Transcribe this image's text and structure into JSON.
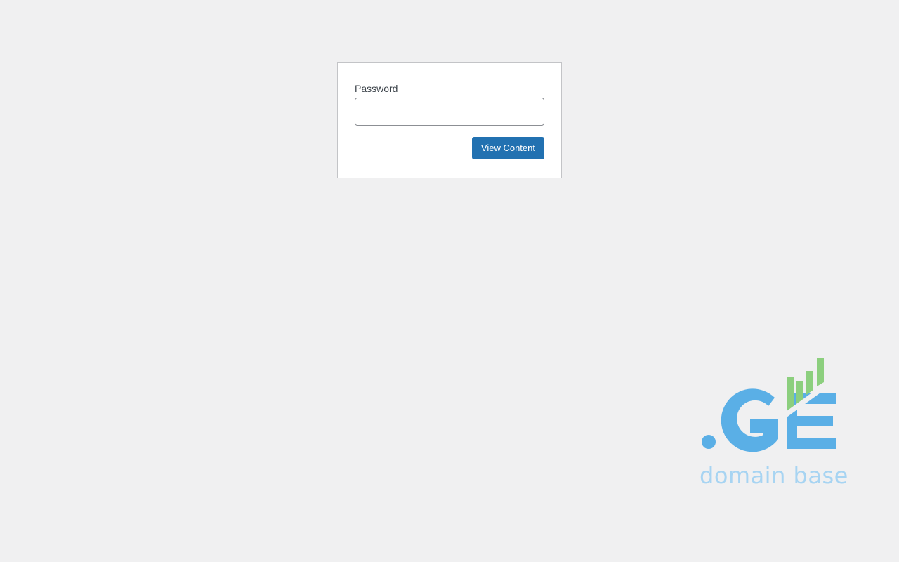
{
  "form": {
    "password_label": "Password",
    "password_value": "",
    "submit_label": "View Content"
  },
  "logo": {
    "wordmark": ".GE",
    "tagline": "domain base",
    "colors": {
      "blue": "#5aafe6",
      "light_blue": "#a7d4f2",
      "green": "#8ccf7e"
    }
  },
  "colors": {
    "background": "#f0f0f1",
    "button": "#2271b1",
    "panel_border": "#c3c4c7"
  }
}
